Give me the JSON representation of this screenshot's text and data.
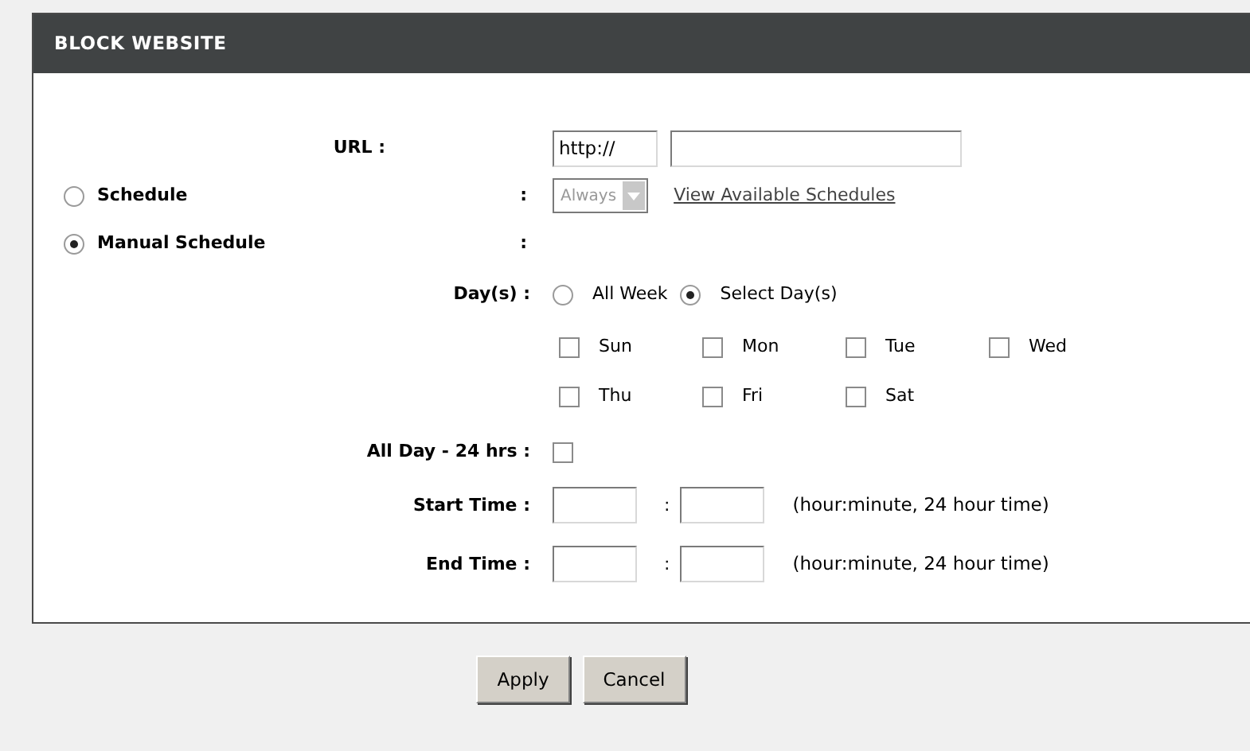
{
  "panel": {
    "title": "BLOCK WEBSITE"
  },
  "url": {
    "label": "URL :",
    "prefix": "http://"
  },
  "schedule_options": [
    {
      "label": "Schedule",
      "selected": false,
      "colon": ":"
    },
    {
      "label": "Manual Schedule",
      "selected": true,
      "colon": ":"
    }
  ],
  "schedule_select": {
    "value": "Always",
    "disabled": true
  },
  "schedule_link": "View Available Schedules",
  "days": {
    "label": "Day(s) :",
    "modes": [
      {
        "label": "All Week",
        "selected": false
      },
      {
        "label": "Select Day(s)",
        "selected": true
      }
    ],
    "items": [
      {
        "label": "Sun",
        "checked": false
      },
      {
        "label": "Mon",
        "checked": false
      },
      {
        "label": "Tue",
        "checked": false
      },
      {
        "label": "Wed",
        "checked": false
      },
      {
        "label": "Thu",
        "checked": false
      },
      {
        "label": "Fri",
        "checked": false
      },
      {
        "label": "Sat",
        "checked": false
      }
    ]
  },
  "all_day": {
    "label": "All Day - 24 hrs :",
    "checked": false
  },
  "times": [
    {
      "label": "Start Time :",
      "separator": ":",
      "note": "(hour:minute, 24 hour time)"
    },
    {
      "label": "End Time :",
      "separator": ":",
      "note": "(hour:minute, 24 hour time)"
    }
  ],
  "buttons": [
    "Apply",
    "Cancel"
  ]
}
